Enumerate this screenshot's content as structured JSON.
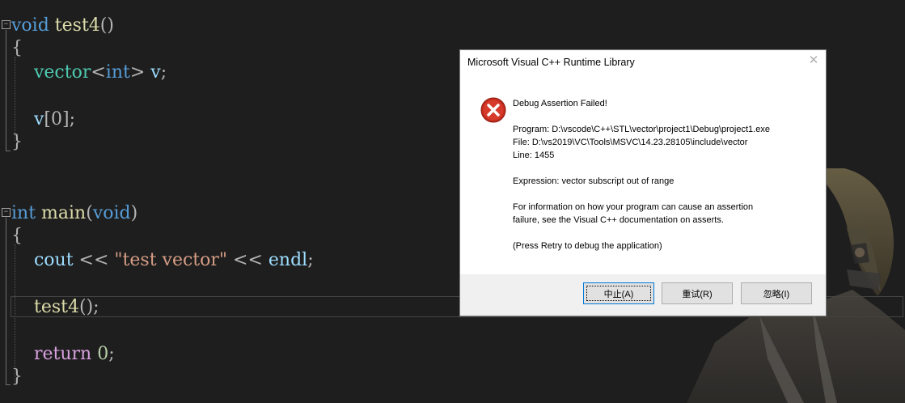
{
  "editor": {
    "lines": {
      "l1": {
        "kw": "void",
        "fn": "test4",
        "rest": "()"
      },
      "l2": {
        "brace": "{"
      },
      "l3": {
        "ty": "vector",
        "lt": "<",
        "kw": "int",
        "gt": ">",
        "id": "v",
        "semi": ";"
      },
      "l4": {
        "id": "v",
        "rest": "[0];"
      },
      "l5": {
        "brace": "}"
      },
      "l6": {
        "kw": "int",
        "fn": "main",
        "po": "(",
        "kw2": "void",
        "pc": ")"
      },
      "l7": {
        "brace": "{"
      },
      "l8": {
        "id": "cout",
        "op1": " << ",
        "str": "\"test vector\"",
        "op2": " << ",
        "id2": "endl",
        "semi": ";"
      },
      "l9": {
        "fn": "test4",
        "rest": "();"
      },
      "l10": {
        "ctl": "return",
        "num": "0",
        "semi": ";"
      },
      "l11": {
        "brace": "}"
      }
    }
  },
  "dialog": {
    "title": "Microsoft Visual C++ Runtime Library",
    "close_glyph": "✕",
    "icon": "error-icon",
    "heading": "Debug Assertion Failed!",
    "program": "Program: D:\\vscode\\C++\\STL\\vector\\project1\\Debug\\project1.exe",
    "file": "File: D:\\vs2019\\VC\\Tools\\MSVC\\14.23.28105\\include\\vector",
    "line": "Line: 1455",
    "expression": "Expression: vector subscript out of range",
    "info1": "For information on how your program can cause an assertion",
    "info2": "failure, see the Visual C++ documentation on asserts.",
    "retry_hint": "(Press Retry to debug the application)",
    "buttons": {
      "abort": "中止(A)",
      "retry": "重试(R)",
      "ignore": "忽略(I)"
    }
  },
  "colors": {
    "editor_bg": "#1e1e1e",
    "keyword": "#569cd6",
    "function": "#dcdcaa",
    "type": "#4ec9b0",
    "string": "#d69d85",
    "error_red": "#c42b1c"
  }
}
